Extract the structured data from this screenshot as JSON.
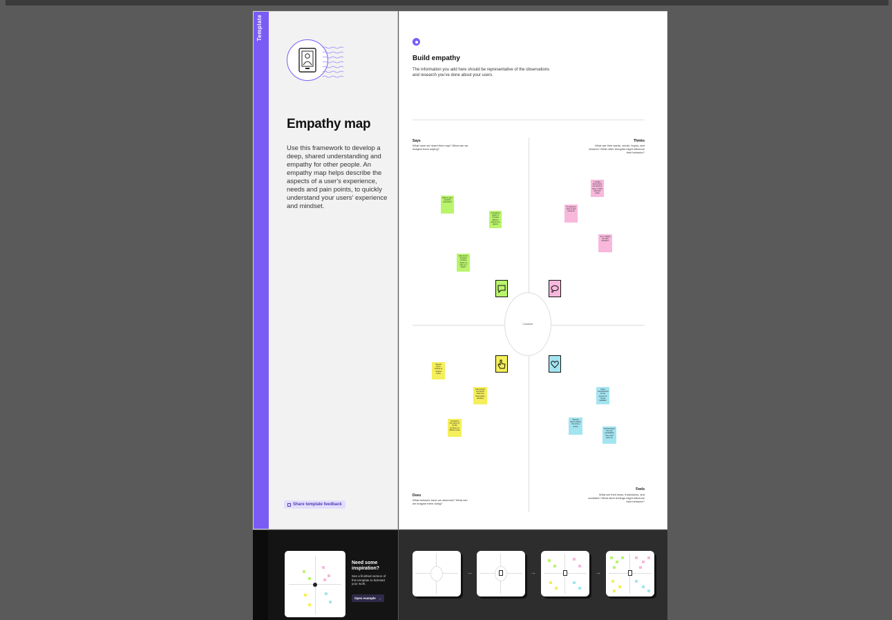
{
  "sidebar": {
    "vertical_label": "Template"
  },
  "intro": {
    "title": "Empathy map",
    "description": "Use this framework to develop a deep, shared understanding and empathy for other people. An empathy map helps describe the aspects of a user's experience, needs and pain points, to quickly understand your users' experience and mindset.",
    "feedback_label": "Share template feedback"
  },
  "main": {
    "step_title": "Build empathy",
    "step_description": "The information you add here should be representative of the observations and research you've done about your users.",
    "center_label": "Customer",
    "quadrants": {
      "says": {
        "title": "Says",
        "question": "What have we heard them say? What can we imagine them saying?"
      },
      "thinks": {
        "title": "Thinks",
        "question": "What are their wants, needs, hopes, and dreams? What other thoughts might influence their behavior?"
      },
      "does": {
        "title": "Does",
        "question": "What behavior have we observed? What can we imagine them doing?"
      },
      "feels": {
        "title": "Feels",
        "question": "What are their fears, frustrations, and anxieties? What other feelings might influence their behavior?"
      }
    },
    "stickies": {
      "g1": "What is your stressful processes?",
      "g2": "It should be easier to compare different options at a glance",
      "g3": "How do the financial numbers match my plan in a week?",
      "p1": "I wonder what others are doing to stay on track with their goals",
      "p2": "I'm going to have to ask someone",
      "p3": "Am I making the right decision?",
      "y1": "Spends hours looking at reviews online",
      "y2": "Asks friends and family what they think before deciding",
      "y3": "Compares the prices of similar products on different sites",
      "c1": "Feels overwhelmed by the amount of choice available",
      "c2": "Worried about making the wrong choice",
      "c3": "Excited about the new possibilities this could open up"
    }
  },
  "inspiration": {
    "title": "Need some inspiration?",
    "description": "See a finished version of this template to kickstart your work.",
    "button_label": "Open example"
  },
  "colors": {
    "accent": "#7a5cf5",
    "green": "#b9f56b",
    "pink": "#f7b8dc",
    "yellow": "#f4ef5a",
    "cyan": "#a3e4f1"
  }
}
